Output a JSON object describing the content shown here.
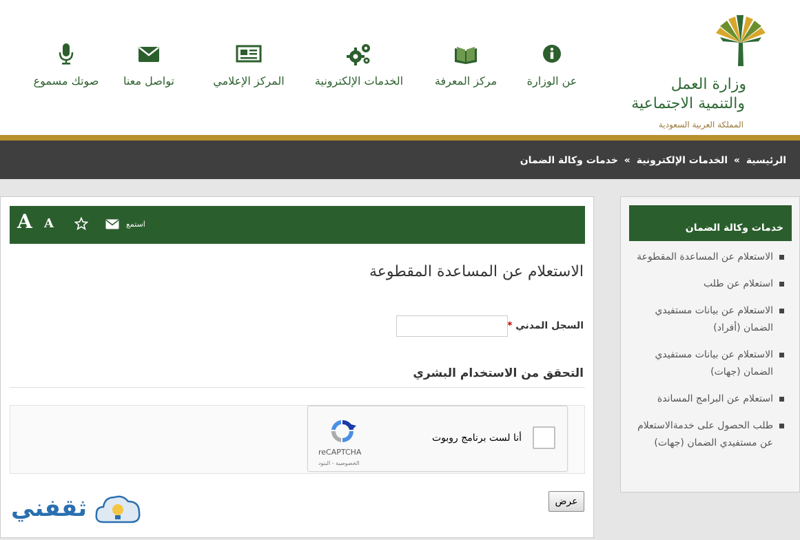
{
  "logo": {
    "line1": "وزارة العمل",
    "line2": "والتنمية الاجتماعية",
    "line3": "المملكة العربية السعودية"
  },
  "nav": [
    {
      "label": "عن الوزارة",
      "icon": "info-icon"
    },
    {
      "label": "مركز المعرفة",
      "icon": "book-icon"
    },
    {
      "label": "الخدمات الإلكترونية",
      "icon": "gears-icon"
    },
    {
      "label": "المركز الإعلامي",
      "icon": "newspaper-icon"
    },
    {
      "label": "تواصل معنا",
      "icon": "envelope-icon"
    },
    {
      "label": "صوتك مسموع",
      "icon": "microphone-icon"
    }
  ],
  "breadcrumb": [
    "الرئيسية",
    "الخدمات الإلكترونية",
    "خدمات وكالة الضمان"
  ],
  "breadcrumb_sep": "»",
  "sidebar": {
    "title": "خدمات وكالة الضمان",
    "items": [
      "الاستعلام عن المساعدة المقطوعة",
      "استعلام عن طلب",
      "الاستعلام عن بيانات مستفيدي الضمان (أفراد)",
      "الاستعلام عن بيانات مستفيدي الضمان (جهات)",
      "استعلام عن البرامج المساندة",
      "طلب الحصول على خدمةالاستعلام عن مستفيدي الضمان (جهات)"
    ]
  },
  "toolbar": {
    "listen_label": "استمع",
    "font_large": "A",
    "font_small": "A"
  },
  "form": {
    "title": "الاستعلام عن المساعدة المقطوعة",
    "civil_label": "السجل المدني",
    "required_mark": "*",
    "civil_value": "",
    "captcha_section": "التحقق من الاستخدام البشري",
    "captcha_label": "أنا لست برنامج روبوت",
    "captcha_brand": "reCAPTCHA",
    "captcha_terms": "الخصوصية - البنود",
    "submit_label": "عرض"
  },
  "watermark": "ثقفني",
  "colors": {
    "brand_green": "#2b5e2d",
    "gold": "#b8902c",
    "crumb_bg": "#3f3f3f"
  }
}
